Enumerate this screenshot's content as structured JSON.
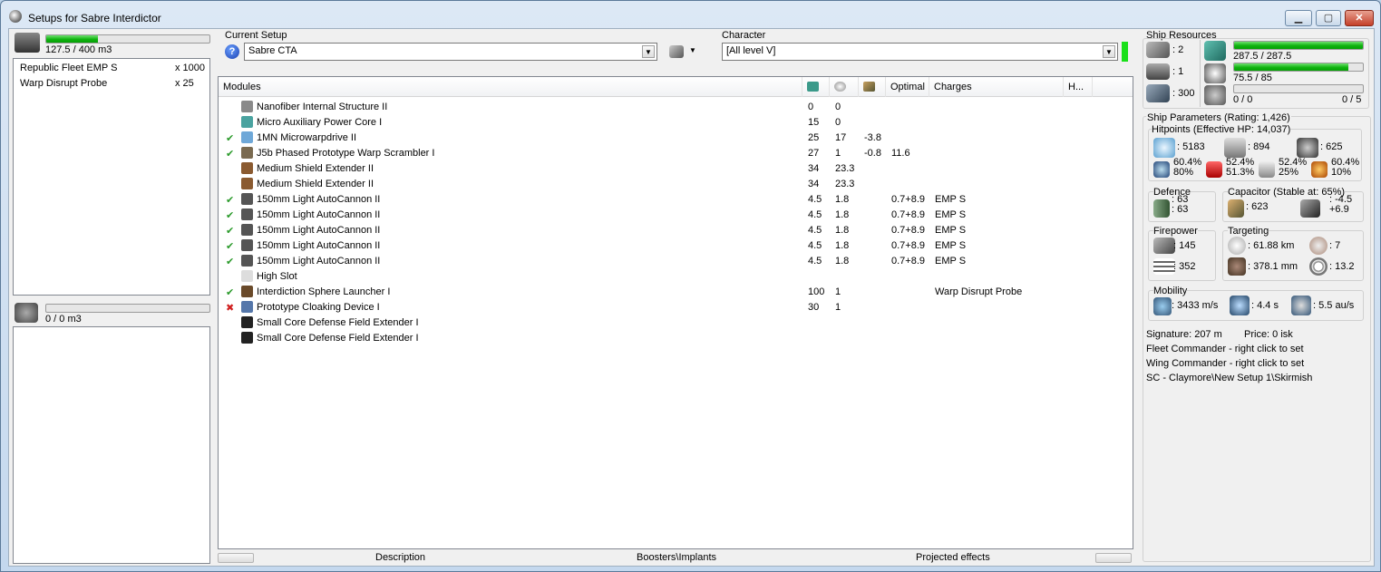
{
  "window": {
    "title": "Setups for Sabre Interdictor",
    "minimize": "▁",
    "maximize": "▢",
    "close": "✕"
  },
  "cargo": {
    "value": "127.5 / 400 m3",
    "fill": 0.319,
    "items": [
      {
        "name": "Republic Fleet EMP S",
        "qty": "x 1000"
      },
      {
        "name": "Warp Disrupt Probe",
        "qty": "x 25"
      }
    ]
  },
  "drones": {
    "value": "0 / 0 m3",
    "fill": 0
  },
  "setup": {
    "label": "Current Setup",
    "value": "Sabre CTA",
    "help": "?"
  },
  "character": {
    "label": "Character",
    "value": "[All level V]"
  },
  "grid": {
    "headers": {
      "modules": "Modules",
      "optimal": "Optimal",
      "charges": "Charges",
      "h": "H..."
    },
    "rows": [
      {
        "check": "",
        "name": "Nanofiber Internal Structure II",
        "c1": "0",
        "c2": "0",
        "c3": "",
        "optimal": "",
        "charges": "",
        "icon": "#8a8a8a"
      },
      {
        "check": "",
        "name": "Micro Auxiliary Power Core I",
        "c1": "15",
        "c2": "0",
        "c3": "",
        "optimal": "",
        "charges": "",
        "icon": "#4aa3a0"
      },
      {
        "check": "✔",
        "name": "1MN Microwarpdrive II",
        "c1": "25",
        "c2": "17",
        "c3": "-3.8",
        "optimal": "",
        "charges": "",
        "icon": "#6fa8d8"
      },
      {
        "check": "✔",
        "name": "J5b Phased Prototype Warp Scrambler I",
        "c1": "27",
        "c2": "1",
        "c3": "-0.8",
        "optimal": "11.6",
        "charges": "",
        "icon": "#7a6a50"
      },
      {
        "check": "",
        "name": "Medium Shield Extender II",
        "c1": "34",
        "c2": "23.3",
        "c3": "",
        "optimal": "",
        "charges": "",
        "icon": "#8a5a30"
      },
      {
        "check": "",
        "name": "Medium Shield Extender II",
        "c1": "34",
        "c2": "23.3",
        "c3": "",
        "optimal": "",
        "charges": "",
        "icon": "#8a5a30"
      },
      {
        "check": "✔",
        "name": "150mm Light AutoCannon II",
        "c1": "4.5",
        "c2": "1.8",
        "c3": "",
        "optimal": "0.7+8.9",
        "charges": "EMP S",
        "icon": "#555"
      },
      {
        "check": "✔",
        "name": "150mm Light AutoCannon II",
        "c1": "4.5",
        "c2": "1.8",
        "c3": "",
        "optimal": "0.7+8.9",
        "charges": "EMP S",
        "icon": "#555"
      },
      {
        "check": "✔",
        "name": "150mm Light AutoCannon II",
        "c1": "4.5",
        "c2": "1.8",
        "c3": "",
        "optimal": "0.7+8.9",
        "charges": "EMP S",
        "icon": "#555"
      },
      {
        "check": "✔",
        "name": "150mm Light AutoCannon II",
        "c1": "4.5",
        "c2": "1.8",
        "c3": "",
        "optimal": "0.7+8.9",
        "charges": "EMP S",
        "icon": "#555"
      },
      {
        "check": "✔",
        "name": "150mm Light AutoCannon II",
        "c1": "4.5",
        "c2": "1.8",
        "c3": "",
        "optimal": "0.7+8.9",
        "charges": "EMP S",
        "icon": "#555"
      },
      {
        "check": "",
        "name": "High Slot",
        "c1": "",
        "c2": "",
        "c3": "",
        "optimal": "",
        "charges": "",
        "icon": "#ddd"
      },
      {
        "check": "✔",
        "name": "Interdiction Sphere Launcher I",
        "c1": "100",
        "c2": "1",
        "c3": "",
        "optimal": "",
        "charges": "Warp Disrupt Probe",
        "icon": "#6a4a2a"
      },
      {
        "check": "✖",
        "name": "Prototype Cloaking Device I",
        "c1": "30",
        "c2": "1",
        "c3": "",
        "optimal": "",
        "charges": "",
        "icon": "#5577aa"
      },
      {
        "check": "",
        "name": "Small Core Defense Field Extender I",
        "c1": "",
        "c2": "",
        "c3": "",
        "optimal": "",
        "charges": "",
        "icon": "#222"
      },
      {
        "check": "",
        "name": "Small Core Defense Field Extender I",
        "c1": "",
        "c2": "",
        "c3": "",
        "optimal": "",
        "charges": "",
        "icon": "#222"
      }
    ]
  },
  "bottom_tabs": {
    "description": "Description",
    "boosters": "Boosters\\Implants",
    "projected": "Projected effects"
  },
  "resources": {
    "title": "Ship Resources",
    "hi": ": 2",
    "med": ": 1",
    "calib": ": 300",
    "cpu": {
      "value": "287.5 / 287.5",
      "fill": 1.0
    },
    "pg": {
      "value": "75.5 / 85",
      "fill": 0.888
    },
    "drone_bw": "0 / 0",
    "drones": "0 / 5"
  },
  "params": {
    "title": "Ship Parameters (Rating: 1,426)",
    "hp_title": "Hitpoints (Effective HP: 14,037)",
    "shield": ": 5183",
    "armor": ": 894",
    "hull": ": 625",
    "res": [
      [
        "60.4%",
        "80%"
      ],
      [
        "52.4%",
        "51.3%"
      ],
      [
        "52.4%",
        "25%"
      ],
      [
        "60.4%",
        "10%"
      ]
    ],
    "defence_title": "Defence",
    "def1": ": 63",
    "def2": ": 63",
    "cap_title": "Capacitor (Stable at: 65%)",
    "cap": ": 623",
    "cap_delta1": ": -4.5",
    "cap_delta2": "+6.9",
    "fire_title": "Firepower",
    "fire1": ": 145",
    "fire2": ": 352",
    "target_title": "Targeting",
    "range": ": 61.88 km",
    "targets": ": 7",
    "scanres": ": 378.1 mm",
    "sensor": ": 13.2",
    "mob_title": "Mobility",
    "speed": ": 3433 m/s",
    "align": ": 4.4 s",
    "warp": ": 5.5 au/s",
    "signature": "Signature: 207 m",
    "price": "Price: 0 isk",
    "fleet": "Fleet Commander - right click to set",
    "wing": "Wing Commander - right click to set",
    "sc": "SC - Claymore\\New Setup 1\\Skirmish"
  }
}
